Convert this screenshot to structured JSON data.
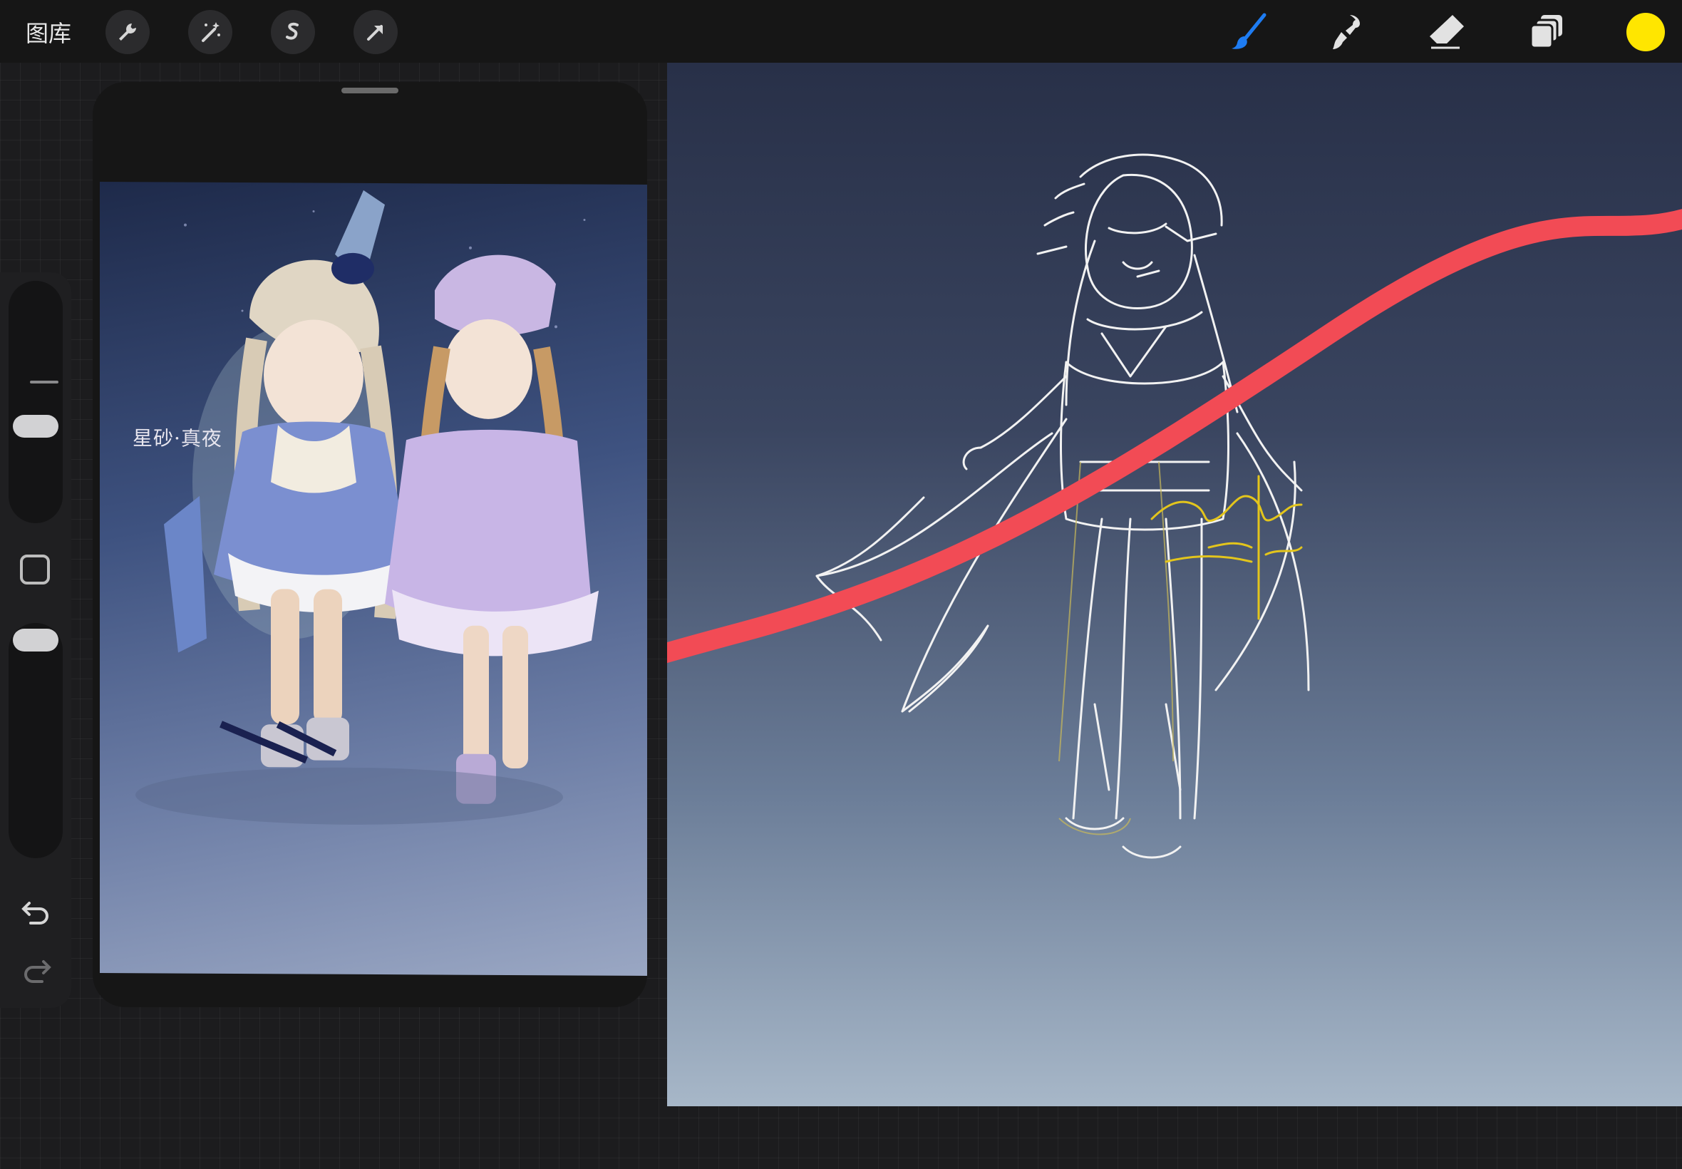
{
  "toolbar": {
    "gallery_label": "图库",
    "left_tools": [
      "wrench-icon",
      "magic-wand-icon",
      "selection-icon",
      "transform-arrow-icon"
    ],
    "right_tools": [
      "brush-icon",
      "smudge-icon",
      "eraser-icon",
      "layers-icon"
    ],
    "current_color": "#ffe600",
    "active_tool_color": "#1e7cf2"
  },
  "reference": {
    "caption": "星砂·真夜"
  },
  "canvas": {
    "signature_color": "#e3c51c",
    "stroke_color": "#f24b55"
  },
  "sidebar": {
    "icons": [
      "square-modifier-icon",
      "undo-icon",
      "redo-icon"
    ]
  }
}
